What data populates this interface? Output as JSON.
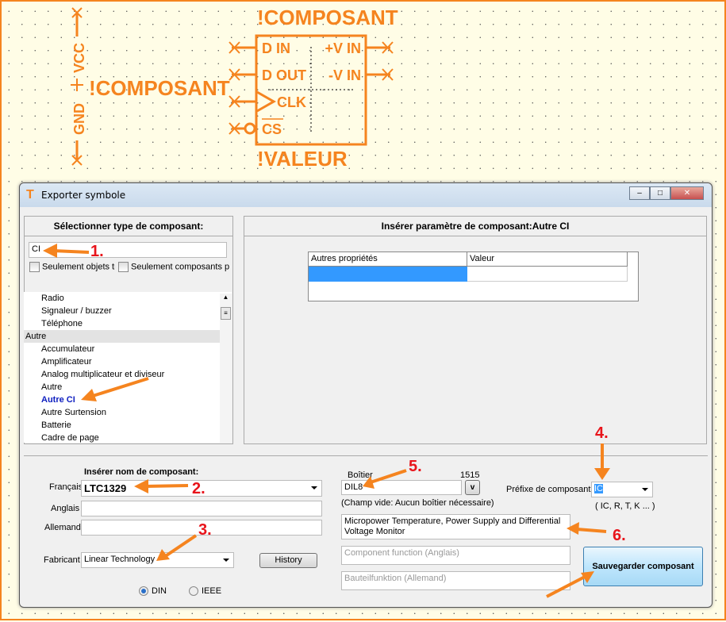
{
  "schematic": {
    "name_top": "!COMPOSANT",
    "name_left": "!COMPOSANT",
    "value": "!VALEUR",
    "vcc": "VCC",
    "gnd": "GND",
    "pins_left": [
      "D IN",
      "D OUT",
      "CLK",
      "CS"
    ],
    "pins_right": [
      "+V IN",
      "-V IN"
    ],
    "color": "#F5841F"
  },
  "window": {
    "title": "Exporter symbole",
    "minimize": "–",
    "maximize": "□",
    "close": "✕"
  },
  "left_panel": {
    "header": "Sélectionner type de composant:",
    "search_value": "CI",
    "checkbox1": "Seulement objets tr",
    "checkbox2": "Seulement composants pr",
    "items": [
      {
        "label": "Radio",
        "type": "item"
      },
      {
        "label": "Signaleur / buzzer",
        "type": "item"
      },
      {
        "label": "Téléphone",
        "type": "item"
      },
      {
        "label": "Autre",
        "type": "cat"
      },
      {
        "label": "Accumulateur",
        "type": "item"
      },
      {
        "label": "Amplificateur",
        "type": "item"
      },
      {
        "label": "Analog multiplicateur et diviseur",
        "type": "item"
      },
      {
        "label": "Autre",
        "type": "item"
      },
      {
        "label": "Autre CI",
        "type": "sel"
      },
      {
        "label": "Autre Surtension",
        "type": "item"
      },
      {
        "label": "Batterie",
        "type": "item"
      },
      {
        "label": "Cadre de page",
        "type": "item"
      }
    ]
  },
  "right_panel": {
    "header": "Insérer paramètre de composant:Autre CI",
    "col1": "Autres propriétés",
    "col2": "Valeur"
  },
  "name_section": {
    "header": "Insérer nom de composant:",
    "francais_label": "Français",
    "francais_value": "LTC1329",
    "anglais_label": "Anglais",
    "anglais_value": "",
    "allemand_label": "Allemand",
    "allemand_value": "",
    "fabricant_label": "Fabricant",
    "fabricant_value": "Linear Technology",
    "history_button": "History",
    "radio_din": "DIN",
    "radio_ieee": "IEEE",
    "selected_standard": "DIN"
  },
  "package": {
    "label": "Boîtier",
    "count": "1515",
    "value": "DIL8",
    "dropdown": "v",
    "hint": "(Champ vide: Aucun boîtier nécessaire)"
  },
  "prefix": {
    "label": "Préfixe de composant:",
    "value": "IC",
    "hint": "( IC, R, T, K ... )"
  },
  "function": {
    "francais": "Micropower Temperature, Power Supply and Differential Voltage Monitor",
    "anglais_placeholder": "Component function (Anglais)",
    "allemand_placeholder": "Bauteilfunktion (Allemand)"
  },
  "save_button": "Sauvegarder composant",
  "annotations": {
    "a1": "1.",
    "a2": "2.",
    "a3": "3.",
    "a4": "4.",
    "a5": "5.",
    "a6": "6.",
    "color": "#F5841F",
    "number_color": "#E8141B"
  }
}
